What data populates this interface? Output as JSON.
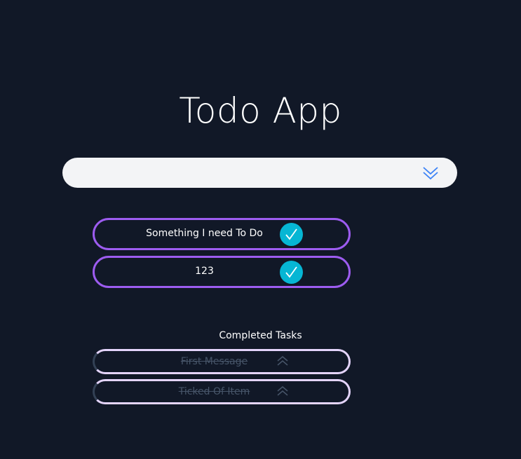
{
  "app": {
    "title": "Todo App"
  },
  "new_task": {
    "value": "",
    "placeholder": "",
    "add_icon": "chevrons-down-icon",
    "add_icon_color": "#3b82f6"
  },
  "tasks": [
    {
      "label": "Something I need To Do",
      "action_icon": "check-icon"
    },
    {
      "label": "123",
      "action_icon": "check-icon"
    }
  ],
  "completed": {
    "heading": "Completed Tasks",
    "items": [
      {
        "label": "First Message",
        "action_icon": "chevrons-up-icon"
      },
      {
        "label": "Ticked Of Item",
        "action_icon": "chevrons-up-icon"
      }
    ]
  },
  "colors": {
    "background": "#111827",
    "task_border": "#9d5cf0",
    "check_button": "#06b6d4",
    "completed_border": "#e4d4fb",
    "completed_text": "#475569"
  }
}
